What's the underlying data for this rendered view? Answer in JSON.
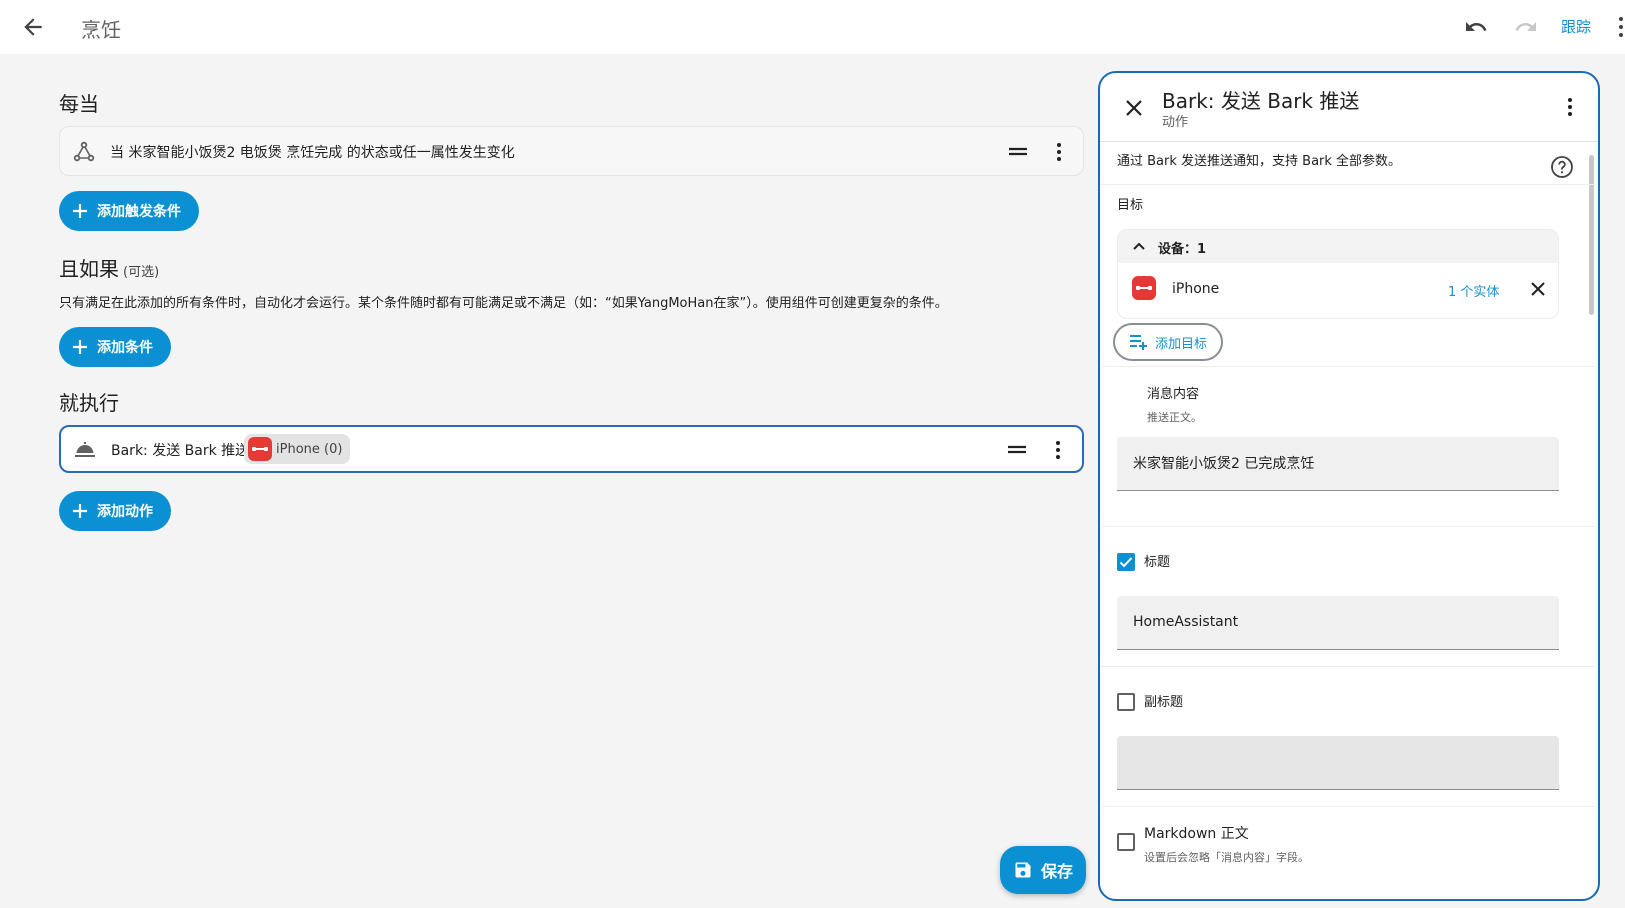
{
  "app": {
    "title": "烹饪",
    "trace_label": "跟踪"
  },
  "triggers": {
    "section_title": "每当",
    "items": [
      {
        "label": "当 米家智能小饭煲2 电饭煲 烹饪完成 的状态或任一属性发生变化"
      }
    ],
    "add_label": "添加触发条件"
  },
  "conditions": {
    "section_title": "且如果",
    "optional": "(可选)",
    "description": "只有满足在此添加的所有条件时，自动化才会运行。某个条件随时都有可能满足或不满足（如：“如果YangMoHan在家”）。使用组件可创建更复杂的条件。",
    "add_label": "添加条件"
  },
  "actions": {
    "section_title": "就执行",
    "items": [
      {
        "label": "Bark: 发送 Bark 推送",
        "chip": "iPhone (0)"
      }
    ],
    "add_label": "添加动作"
  },
  "save_label": "保存",
  "panel": {
    "title": "Bark: 发送 Bark 推送",
    "subtitle": "动作",
    "description": "通过 Bark 发送推送通知，支持 Bark 全部参数。",
    "target_label": "目标",
    "target_group": "设备：1",
    "target_device": "iPhone",
    "target_entities": "1 个实体",
    "add_target": "添加目标",
    "message_label": "消息内容",
    "message_hint": "推送正文。",
    "message_value": "米家智能小饭煲2 已完成烹饪",
    "title_field_label": "标题",
    "title_checked": true,
    "title_value": "HomeAssistant",
    "subtitle_field_label": "副标题",
    "subtitle_checked": false,
    "subtitle_value": "",
    "markdown_label": "Markdown 正文",
    "markdown_checked": false,
    "markdown_hint": "设置后会忽略「消息内容」字段。"
  },
  "colors": {
    "accent": "#0b90d3",
    "link": "#1a8fd0",
    "panel_border": "#1a6ab8",
    "bark_red": "#e53935"
  }
}
